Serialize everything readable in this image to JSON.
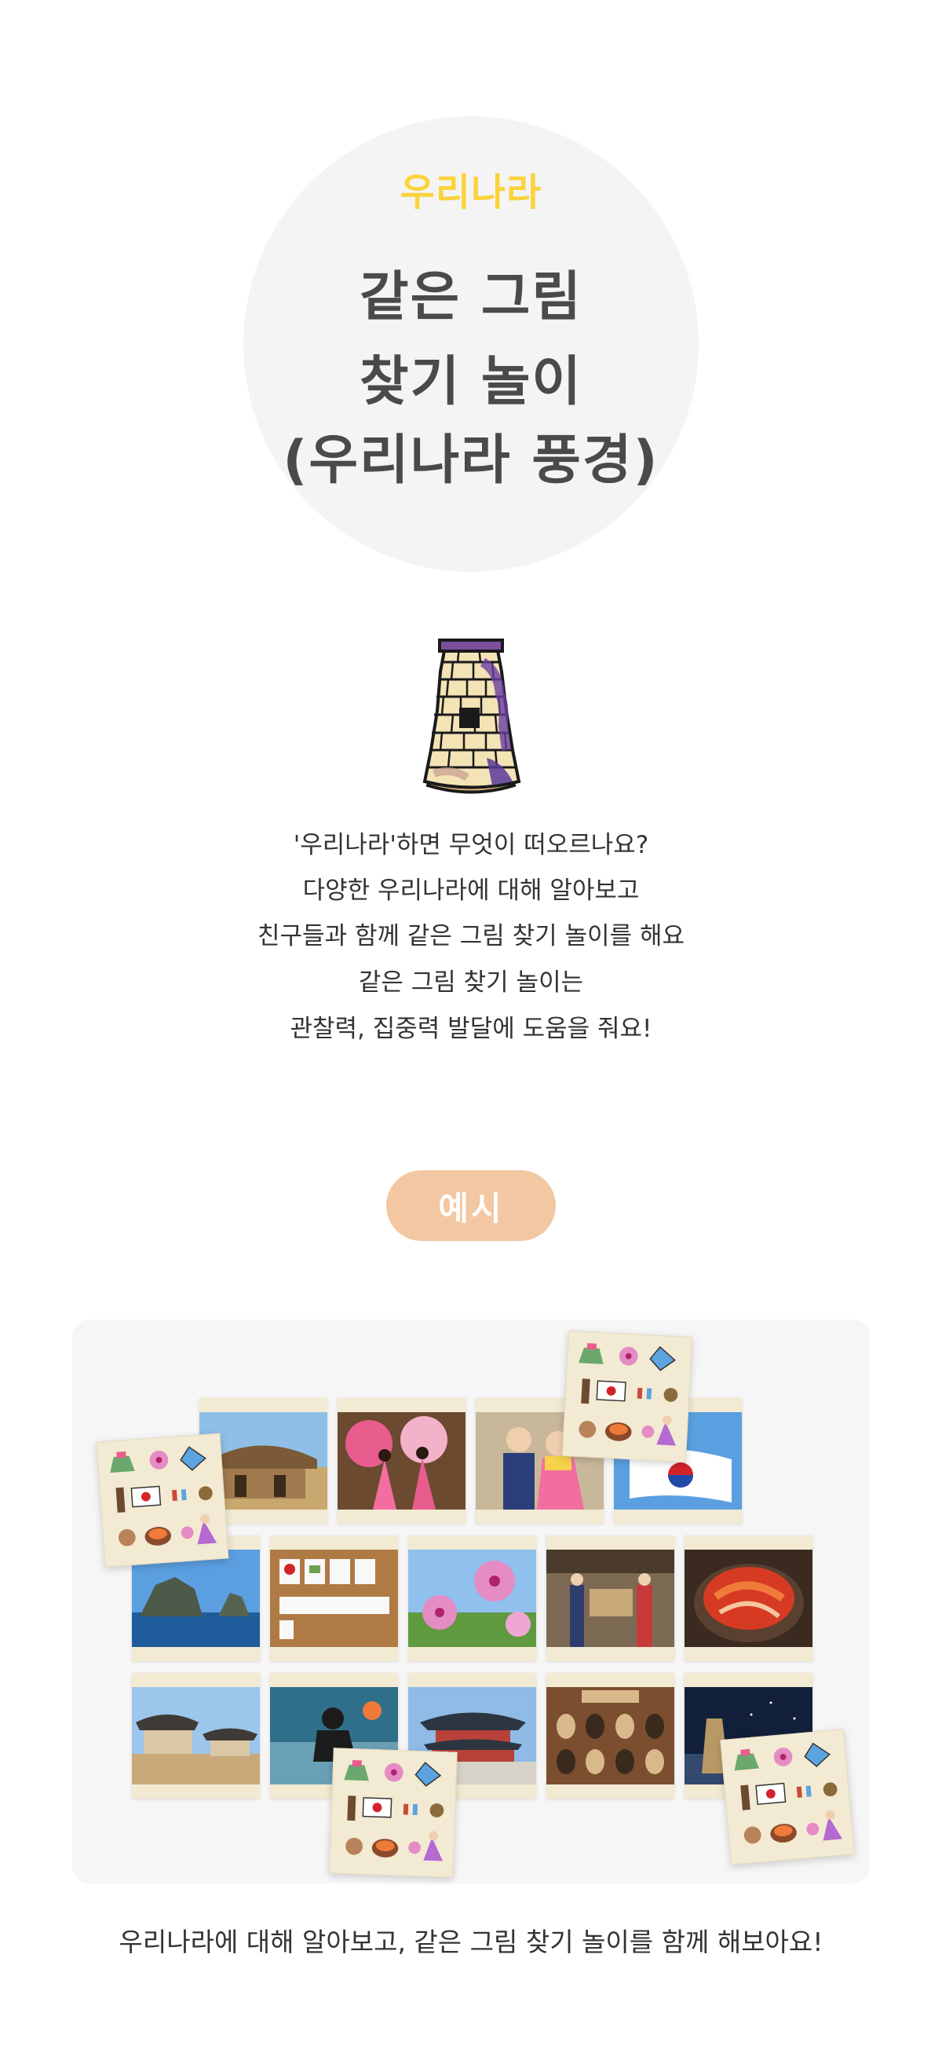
{
  "hero": {
    "eyebrow": "우리나라",
    "title_line1": "같은 그림",
    "title_line2": "찾기 놀이",
    "title_line3": "(우리나라 풍경)"
  },
  "intro": {
    "lines": [
      "'우리나라'하면 무엇이 떠오르나요?",
      "다양한 우리나라에 대해 알아보고",
      "친구들과 함께 같은 그림 찾기 놀이를 해요",
      "같은 그림 찾기 놀이는",
      "관찰력, 집중력 발달에 도움을 줘요!"
    ]
  },
  "example": {
    "badge": "예시",
    "cards": [
      {
        "name": "thatched-house",
        "colors": [
          "#8fbfe6",
          "#7a5a37",
          "#c9a86f"
        ]
      },
      {
        "name": "fan-dance",
        "colors": [
          "#6b4a2f",
          "#e85d8d",
          "#f3b2c9"
        ]
      },
      {
        "name": "hanbok-children",
        "colors": [
          "#c9b79a",
          "#2a3f7a",
          "#f26ea0"
        ]
      },
      {
        "name": "taegukgi",
        "colors": [
          "#5aa0e0",
          "#ffffff",
          "#d2232a"
        ]
      },
      {
        "name": "dokdo",
        "colors": [
          "#5b9fe0",
          "#4d5a4a",
          "#1f5c9c"
        ]
      },
      {
        "name": "word-cards",
        "colors": [
          "#b07a45",
          "#f8f8f8",
          "#6fa04e"
        ]
      },
      {
        "name": "mugunghwa",
        "colors": [
          "#8fc0ee",
          "#e58cc4",
          "#5f9a3e"
        ]
      },
      {
        "name": "traditional-wedding",
        "colors": [
          "#7d6a55",
          "#c63a3a",
          "#2d3c6a"
        ]
      },
      {
        "name": "kimchi",
        "colors": [
          "#3a2a20",
          "#d63a22",
          "#f07a3a"
        ]
      },
      {
        "name": "hanok-village",
        "colors": [
          "#9cc6ec",
          "#3e3a36",
          "#c9a87a"
        ]
      },
      {
        "name": "haenyeo",
        "colors": [
          "#2f6f8a",
          "#1c1c1c",
          "#6aa0b5"
        ]
      },
      {
        "name": "palace",
        "colors": [
          "#8fbbe6",
          "#2d3640",
          "#b8423a"
        ]
      },
      {
        "name": "masks",
        "colors": [
          "#7a4e2e",
          "#d9b98c",
          "#3a2a1e"
        ]
      },
      {
        "name": "cheomseongdae-night",
        "colors": [
          "#121f3a",
          "#33496e",
          "#b89966"
        ]
      }
    ],
    "back_icons": [
      "hanbok-icon",
      "mugunghwa-icon",
      "kite-icon",
      "jangseung-icon",
      "taegukgi-icon",
      "norigae-icon",
      "yutnori-icon",
      "mask-icon",
      "bibimbap-icon",
      "beoseon-icon",
      "hanbok-doll-icon"
    ]
  },
  "footer": {
    "text": "우리나라에 대해 알아보고, 같은 그림 찾기 놀이를 함께 해보아요!"
  },
  "colors": {
    "eyebrow": "#fbd33b",
    "title": "#4a4a4a",
    "badge": "#f2c7a2",
    "circle": "#f4f4f4",
    "board": "#f6f6f6",
    "card": "#f3ead3"
  }
}
